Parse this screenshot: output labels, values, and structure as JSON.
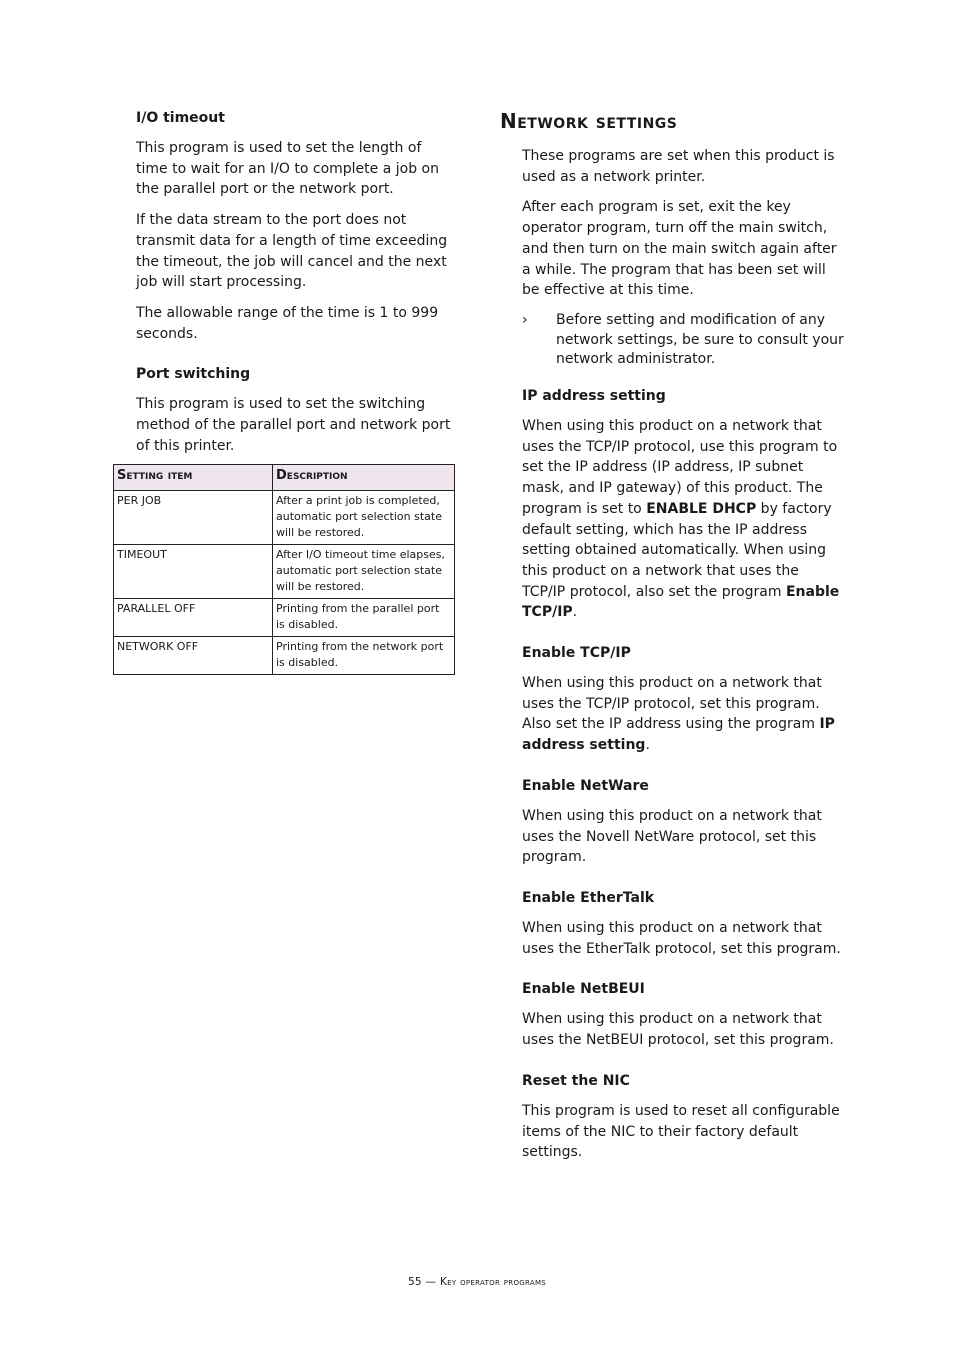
{
  "left": {
    "io_timeout": {
      "heading": "I/O timeout",
      "paragraphs": [
        "This program is used to set the length of time to wait for an I/O to complete a job on the parallel port or the network port.",
        "If the data stream to the port does not transmit data for a length of time exceeding the timeout, the job will cancel and the next job will start processing.",
        "The allowable range of the time is 1 to 999 seconds."
      ]
    },
    "port_switching": {
      "heading": "Port switching",
      "paragraph": "This program is used to set the switching method of the parallel port and network port of this printer."
    },
    "table": {
      "headers": [
        "Setting item",
        "Description"
      ],
      "rows": [
        [
          "PER JOB",
          "After a print job is completed, automatic port selection state will be restored."
        ],
        [
          "TIMEOUT",
          "After I/O timeout time elapses, automatic port selection state will be restored."
        ],
        [
          "PARALLEL OFF",
          "Printing from the parallel port is disabled."
        ],
        [
          "NETWORK OFF",
          "Printing from the network port is disabled."
        ]
      ]
    }
  },
  "right": {
    "title": "Network settings",
    "intro": [
      "These programs are set when this product is used as a network printer.",
      "After each program is set, exit the key operator program, turn off the main switch, and then turn on the main switch again after a while. The program that has been set will be effective at this time."
    ],
    "note": {
      "marker": "›",
      "text": "Before setting and modification of any network settings, be sure to consult your network administrator."
    },
    "ip_address": {
      "heading": "IP address setting",
      "text_a": "When using this product on a network that uses the TCP/IP protocol, use this program to set the IP address (IP address, IP subnet mask, and IP gateway) of this product. The program is set to ",
      "bold_a": "ENABLE DHCP",
      "text_b": " by factory default setting, which has the IP address setting obtained automatically. When using this product on a network that uses the TCP/IP protocol, also set the program ",
      "bold_b": "Enable TCP/IP",
      "text_c": "."
    },
    "enable_tcpip": {
      "heading": "Enable TCP/IP",
      "text_a": "When using this product on a network that uses the TCP/IP protocol, set this program. Also set the IP address using the program ",
      "bold_a": "IP address setting",
      "text_b": "."
    },
    "enable_netware": {
      "heading": "Enable NetWare",
      "text": "When using this product on a network that uses the Novell NetWare protocol, set this program."
    },
    "enable_ethertalk": {
      "heading": "Enable EtherTalk",
      "text": "When using this product on a network that uses the EtherTalk protocol, set this program."
    },
    "enable_netbeui": {
      "heading": "Enable NetBEUI",
      "text": "When using this product on a network that uses the NetBEUI protocol, set this program."
    },
    "reset_nic": {
      "heading": "Reset the NIC",
      "text": "This program is used to reset all configurable items of the NIC to their factory default settings."
    }
  },
  "footer": "55 — Key operator programs"
}
